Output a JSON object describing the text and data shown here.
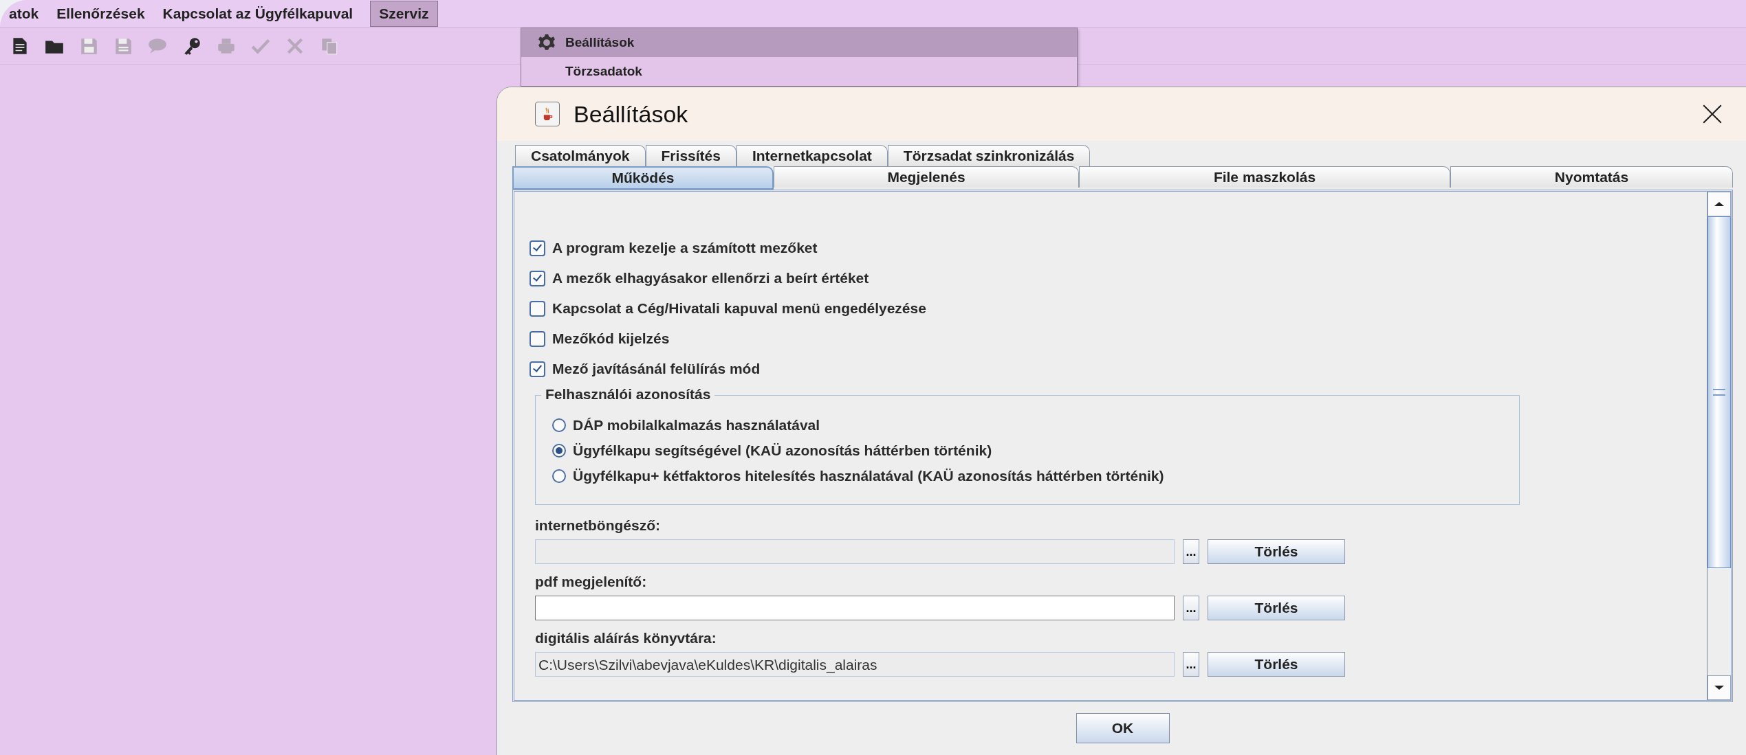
{
  "menu_bar": {
    "items": [
      {
        "label": "atok",
        "selected": false
      },
      {
        "label": "Ellenőrzések",
        "selected": false
      },
      {
        "label": "Kapcsolat az Ügyfélkapuval",
        "selected": false
      },
      {
        "label": "Szerviz",
        "selected": true
      }
    ]
  },
  "toolbar": {
    "buttons": [
      {
        "kind": "document",
        "disabled": false
      },
      {
        "kind": "folder",
        "disabled": false
      },
      {
        "kind": "floppy",
        "disabled": true
      },
      {
        "kind": "floppy-lines",
        "disabled": true
      },
      {
        "kind": "bubble",
        "disabled": true
      },
      {
        "kind": "key",
        "disabled": false
      },
      {
        "kind": "printer",
        "disabled": true
      },
      {
        "kind": "check",
        "disabled": true
      },
      {
        "kind": "cross",
        "disabled": true
      },
      {
        "kind": "copy",
        "disabled": true
      }
    ]
  },
  "menu": {
    "items": [
      {
        "label": "Beállítások",
        "selected": true,
        "kind": "gear"
      },
      {
        "label": "Törzsadatok",
        "selected": false,
        "kind": "plain"
      }
    ]
  },
  "dialog": {
    "title": "Beállítások",
    "tab_rows": [
      [
        {
          "label": "Csatolmányok",
          "selected": false
        },
        {
          "label": "Frissítés",
          "selected": false
        },
        {
          "label": "Internetkapcsolat",
          "selected": false
        },
        {
          "label": "Törzsadat szinkronizálás",
          "selected": false
        }
      ],
      [
        {
          "label": "Működés",
          "selected": true
        },
        {
          "label": "Megjelenés",
          "selected": false
        },
        {
          "label": "File maszkolás",
          "selected": false
        },
        {
          "label": "Nyomtatás",
          "selected": false
        }
      ]
    ],
    "checkboxes": [
      {
        "label": "A program kezelje a számított mezőket",
        "checked": true
      },
      {
        "label": "A mezők elhagyásakor ellenőrzi a beírt értéket",
        "checked": true
      },
      {
        "label": "Kapcsolat a Cég/Hivatali kapuval menü engedélyezése",
        "checked": false
      },
      {
        "label": "Mezőkód kijelzés",
        "checked": false
      },
      {
        "label": "Mező javításánál felülírás mód",
        "checked": true
      }
    ],
    "group": {
      "title": "Felhasználói azonosítás",
      "options": [
        {
          "label": "DÁP mobilalkalmazás használatával",
          "selected": false
        },
        {
          "label": "Ügyfélkapu segítségével (KAÜ azonosítás háttérben történik)",
          "selected": true
        },
        {
          "label": "Ügyfélkapu+ kétfaktoros hitelesítés használatával (KAÜ azonosítás háttérben történik)",
          "selected": false
        }
      ]
    },
    "fields": [
      {
        "label": "internetböngésző:",
        "disabled": true,
        "browse": "...",
        "clear": "Törlés"
      },
      {
        "label": "pdf megjelenítő:",
        "disabled": false,
        "browse": "...",
        "clear": "Törlés"
      },
      {
        "label": "digitális aláírás könyvtára:",
        "value": "C:\\Users\\Szilvi\\abevjava\\eKuldes\\KR\\digitalis_alairas",
        "disabled": true,
        "browse": "...",
        "clear": "Törlés"
      }
    ],
    "ok": "OK"
  }
}
